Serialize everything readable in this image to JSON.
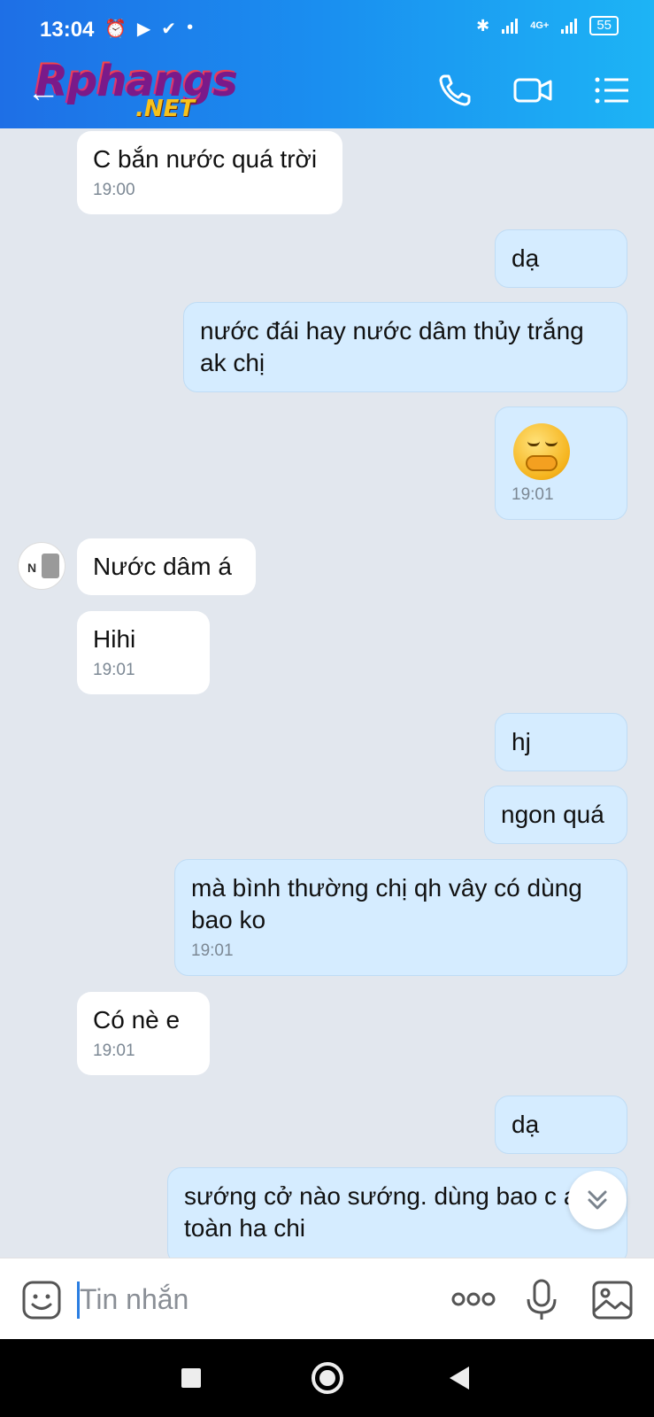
{
  "status_bar": {
    "time": "13:04",
    "battery": "55",
    "network": "4G+"
  },
  "watermark": {
    "main": "Rphangs",
    "suffix": ".NET"
  },
  "icons": {
    "call": "phone-icon",
    "video": "video-camera-icon",
    "menu": "list-menu-icon",
    "back": "back-arrow-icon",
    "sticker": "sticker-smile-icon",
    "more": "more-dots-icon",
    "mic": "microphone-icon",
    "image": "image-icon",
    "scroll": "chevron-double-down-icon"
  },
  "colors": {
    "header_start": "#1e6fe6",
    "header_end": "#1db4f5",
    "incoming_bubble": "#ffffff",
    "outgoing_bubble": "#d5ecff",
    "background": "#e2e7ee"
  },
  "messages": [
    {
      "direction": "in",
      "text": "C bắn nước quá trời",
      "time": "19:00"
    },
    {
      "direction": "out",
      "text": "dạ",
      "time": ""
    },
    {
      "direction": "out",
      "text": "nước đái hay nước dâm thủy trắng ak chị",
      "time": ""
    },
    {
      "direction": "out",
      "text": "",
      "emoji": "face-with-hand-over-mouth",
      "time": "19:01"
    },
    {
      "direction": "in",
      "text": "Nước dâm á",
      "time": ""
    },
    {
      "direction": "in",
      "text": "Hihi",
      "time": "19:01"
    },
    {
      "direction": "out",
      "text": "hj",
      "time": ""
    },
    {
      "direction": "out",
      "text": "ngon quá",
      "time": ""
    },
    {
      "direction": "out",
      "text": "mà bình thường chị qh vây có dùng bao ko",
      "time": "19:01"
    },
    {
      "direction": "in",
      "text": "Có nè e",
      "time": "19:01"
    },
    {
      "direction": "out",
      "text": "dạ",
      "time": ""
    },
    {
      "direction": "out",
      "text": "sướng cở nào sướng. dùng bao c an toàn ha chi",
      "time": ""
    }
  ],
  "input": {
    "placeholder": "Tin nhắn"
  }
}
